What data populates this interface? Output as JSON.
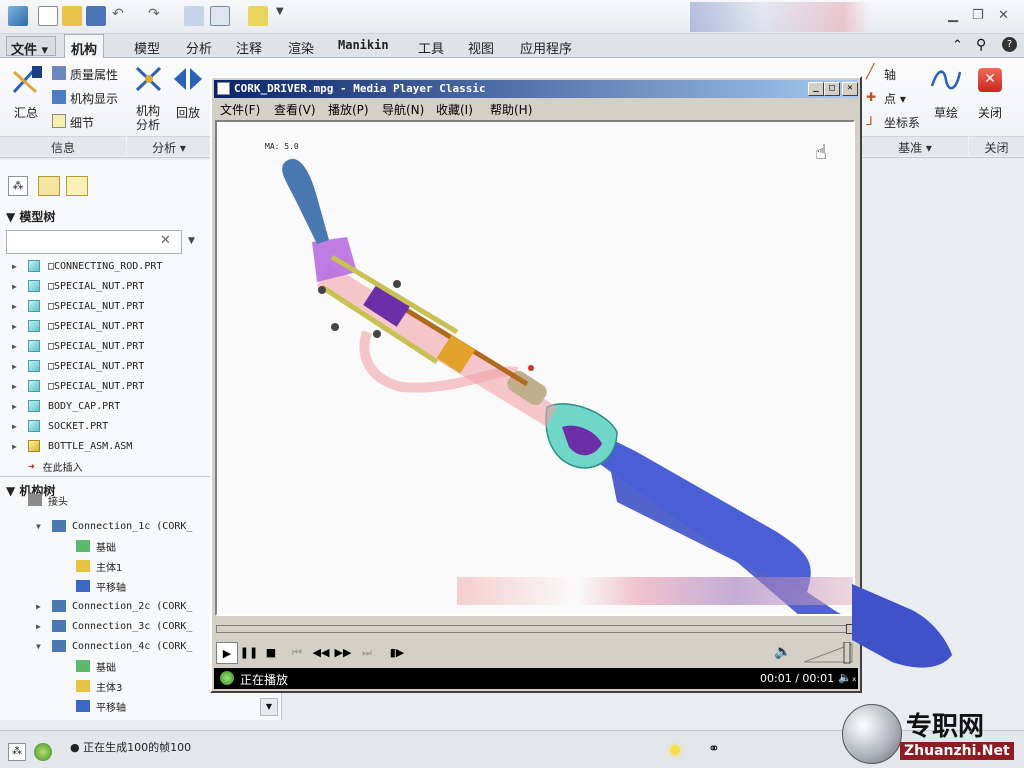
{
  "ribbon_tabs": [
    "文件",
    "机构",
    "模型",
    "分析",
    "注释",
    "渲染",
    "Manikin",
    "工具",
    "视图",
    "应用程序"
  ],
  "ribbon": {
    "summary": "汇总",
    "mass_props": "质量属性",
    "mech_display": "机构显示",
    "details": "细节",
    "mech_analysis": [
      "机构",
      "分析"
    ],
    "playback": "回放",
    "axis": "轴",
    "point": "点",
    "csys": "坐标系",
    "sketch": "草绘",
    "close": "关闭",
    "group_info": "信息",
    "group_analysis": "分析",
    "group_datum": "基准",
    "group_close": "关闭"
  },
  "panel": {
    "model_tree_title": "模型树",
    "mech_tree_title": "机构树",
    "model_tree": [
      {
        "label": "□CONNECTING_ROD.PRT",
        "icon": "part-icon"
      },
      {
        "label": "□SPECIAL_NUT.PRT",
        "icon": "part-icon"
      },
      {
        "label": "□SPECIAL_NUT.PRT",
        "icon": "part-icon"
      },
      {
        "label": "□SPECIAL_NUT.PRT",
        "icon": "part-icon"
      },
      {
        "label": "□SPECIAL_NUT.PRT",
        "icon": "part-icon"
      },
      {
        "label": "□SPECIAL_NUT.PRT",
        "icon": "part-icon"
      },
      {
        "label": "□SPECIAL_NUT.PRT",
        "icon": "part-icon"
      },
      {
        "label": "BODY_CAP.PRT",
        "icon": "part-icon"
      },
      {
        "label": "SOCKET.PRT",
        "icon": "part-icon"
      },
      {
        "label": "BOTTLE_ASM.ASM",
        "icon": "assembly-icon"
      },
      {
        "label": "在此插入",
        "icon": "insert-arrow-icon"
      }
    ],
    "mech_tree": [
      {
        "label": "接头",
        "indent": 1
      },
      {
        "label": "Connection_1c  (CORK_",
        "indent": 2
      },
      {
        "label": "基础",
        "indent": 3
      },
      {
        "label": "主体1",
        "indent": 3
      },
      {
        "label": "平移轴",
        "indent": 3
      },
      {
        "label": "Connection_2c  (CORK_",
        "indent": 2
      },
      {
        "label": "Connection_3c  (CORK_",
        "indent": 2
      },
      {
        "label": "Connection_4c  (CORK_",
        "indent": 2
      },
      {
        "label": "基础",
        "indent": 3
      },
      {
        "label": "主体3",
        "indent": 3
      },
      {
        "label": "平移轴",
        "indent": 3
      }
    ]
  },
  "status": {
    "message": "正在生成100的帧100"
  },
  "player": {
    "title": "CORK_DRIVER.mpg - Media Player Classic",
    "menu": [
      "文件(F)",
      "查看(V)",
      "播放(P)",
      "导航(N)",
      "收藏(I)",
      "帮助(H)"
    ],
    "overlay_text": "MA: 5.0",
    "state": "正在播放",
    "time": "00:01 / 00:01",
    "progress": 1.0
  },
  "watermark": {
    "cn": "专职网",
    "url": "Zhuanzhi.Net"
  },
  "colors": {
    "title_active": "#0a246a",
    "bottle": "#3f52c9",
    "socket": "#6fd6c8",
    "handle": "#4a78b0",
    "frame": "#f0a3a8"
  }
}
